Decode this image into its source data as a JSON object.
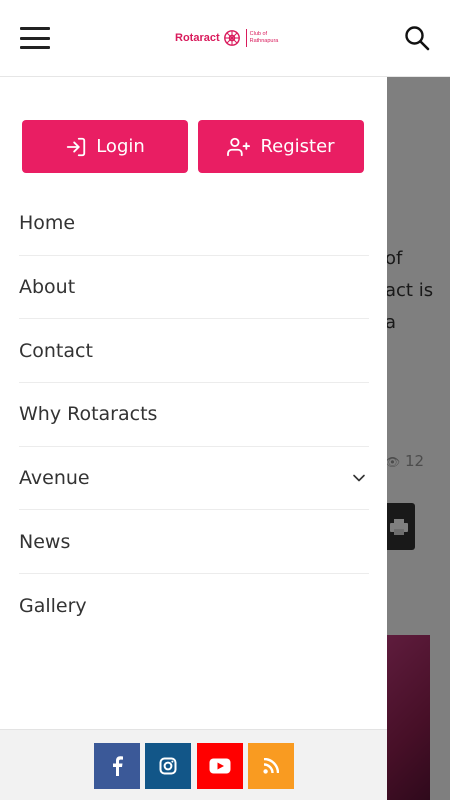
{
  "header": {
    "logo_word": "Rotaract",
    "logo_line1": "Club of",
    "logo_line2": "Rathnapura"
  },
  "background": {
    "text_lines": [
      "of",
      "act is",
      "a"
    ],
    "views_count": "12"
  },
  "drawer": {
    "login_label": "Login",
    "register_label": "Register",
    "menu": [
      "Home",
      "About",
      "Contact",
      "Why Rotaracts",
      "Avenue",
      "News",
      "Gallery"
    ]
  },
  "social": {
    "facebook_color": "#3b5998",
    "instagram_color": "#125688",
    "youtube_color": "#ff0000",
    "rss_color": "#f99b21"
  },
  "colors": {
    "accent": "#e91e63"
  }
}
